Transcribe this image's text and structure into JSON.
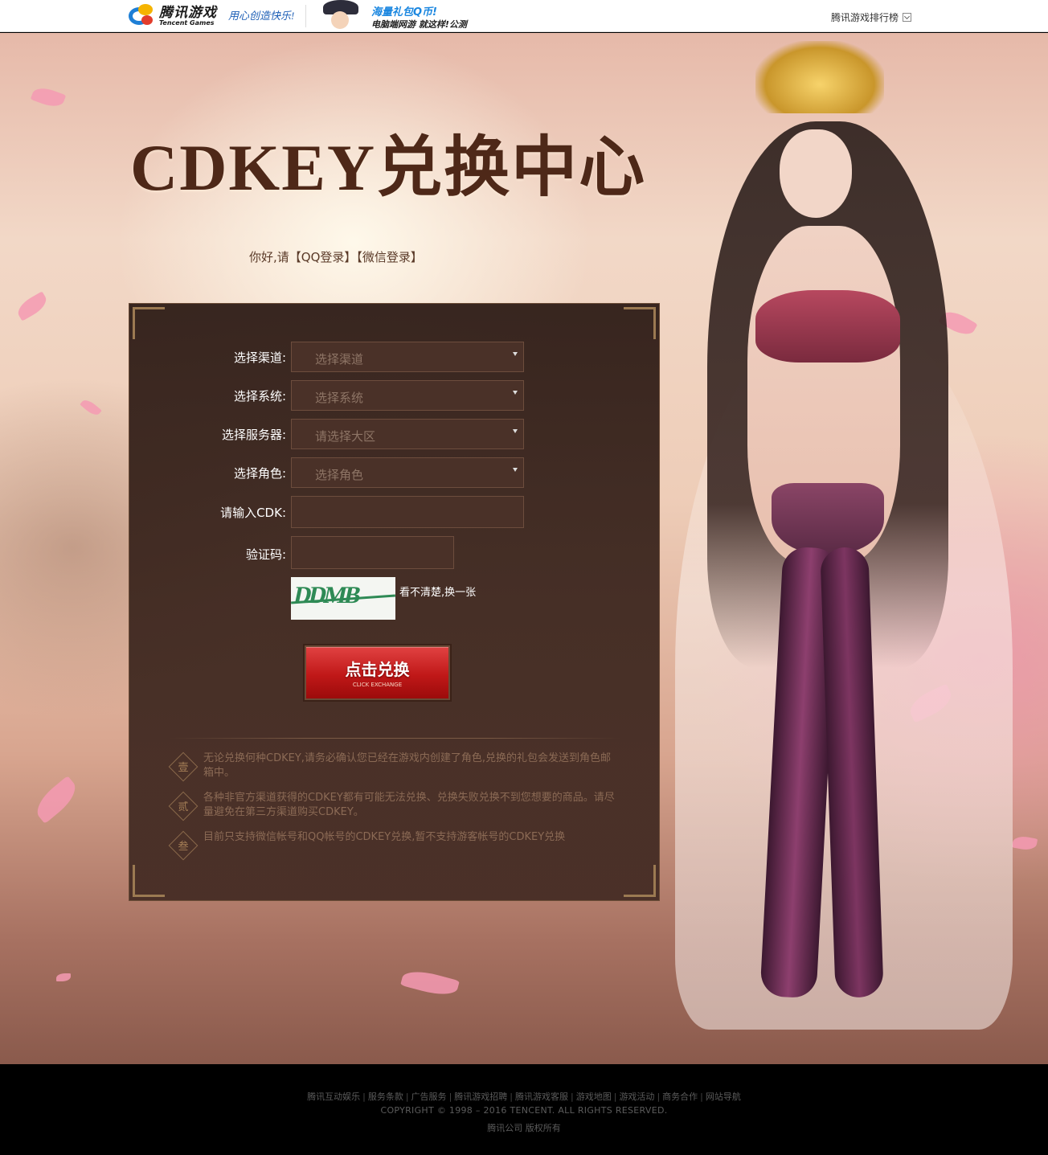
{
  "topbar": {
    "logo_cn": "腾讯游戏",
    "logo_en": "Tencent Games",
    "slogan": "用心创造快乐!",
    "ad_line1": "海量礼包Q币!",
    "ad_line2": "电脑端网游 就这样!公测",
    "rank_label": "腾讯游戏排行榜"
  },
  "hero": {
    "title": "CDKEY兑换中心",
    "greeting_prefix": "你好,请",
    "qq_login": "【QQ登录】",
    "wechat_login": "【微信登录】"
  },
  "form": {
    "channel_label": "选择渠道:",
    "channel_value": "选择渠道",
    "system_label": "选择系统:",
    "system_value": "选择系统",
    "server_label": "选择服务器:",
    "server_value": "请选择大区",
    "role_label": "选择角色:",
    "role_value": "选择角色",
    "cdk_label": "请输入CDK:",
    "cdk_value": "",
    "captcha_label": "验证码:",
    "captcha_value": "",
    "captcha_image_text": "DDMB",
    "refresh_label": "看不清楚,换一张",
    "submit_label": "点击兑换",
    "submit_sub": "CLICK EXCHANGE"
  },
  "notes": [
    {
      "num": "壹",
      "text": "无论兑换何种CDKEY,请务必确认您已经在游戏内创建了角色,兑换的礼包会发送到角色邮箱中。"
    },
    {
      "num": "贰",
      "text": "各种非官方渠道获得的CDKEY都有可能无法兑换、兑换失败兑换不到您想要的商品。请尽量避免在第三方渠道购买CDKEY。"
    },
    {
      "num": "叁",
      "text": "目前只支持微信帐号和QQ帐号的CDKEY兑换,暂不支持游客帐号的CDKEY兑换"
    }
  ],
  "footer": {
    "links": [
      "腾讯互动娱乐",
      "服务条款",
      "广告服务",
      "腾讯游戏招聘",
      "腾讯游戏客服",
      "游戏地图",
      "游戏活动",
      "商务合作",
      "网站导航"
    ],
    "copyright": "COPYRIGHT © 1998 – 2016 TENCENT. ALL RIGHTS RESERVED.",
    "rights": "腾讯公司 版权所有"
  }
}
